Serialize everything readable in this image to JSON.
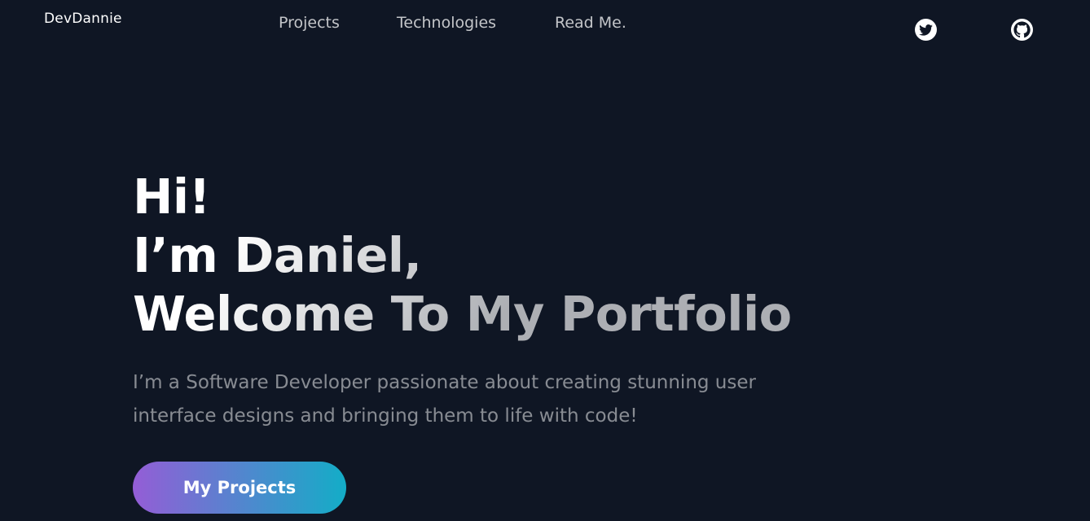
{
  "header": {
    "logo": "DevDannie",
    "nav": [
      {
        "label": "Projects"
      },
      {
        "label": "Technologies"
      },
      {
        "label": "Read Me."
      }
    ],
    "social": [
      {
        "icon": "twitter-icon"
      },
      {
        "icon": "github-icon"
      }
    ]
  },
  "hero": {
    "title_line1": "Hi!",
    "title_line2": "I’m Daniel,",
    "title_line3": "Welcome To My Portfolio",
    "description": "I’m a Software Developer passionate about creating stunning user interface designs and bringing them to life with code!",
    "cta_label": "My Projects"
  },
  "colors": {
    "background": "#0f1624",
    "cta_gradient_start": "#945dd6",
    "cta_gradient_end": "#13adc7"
  }
}
